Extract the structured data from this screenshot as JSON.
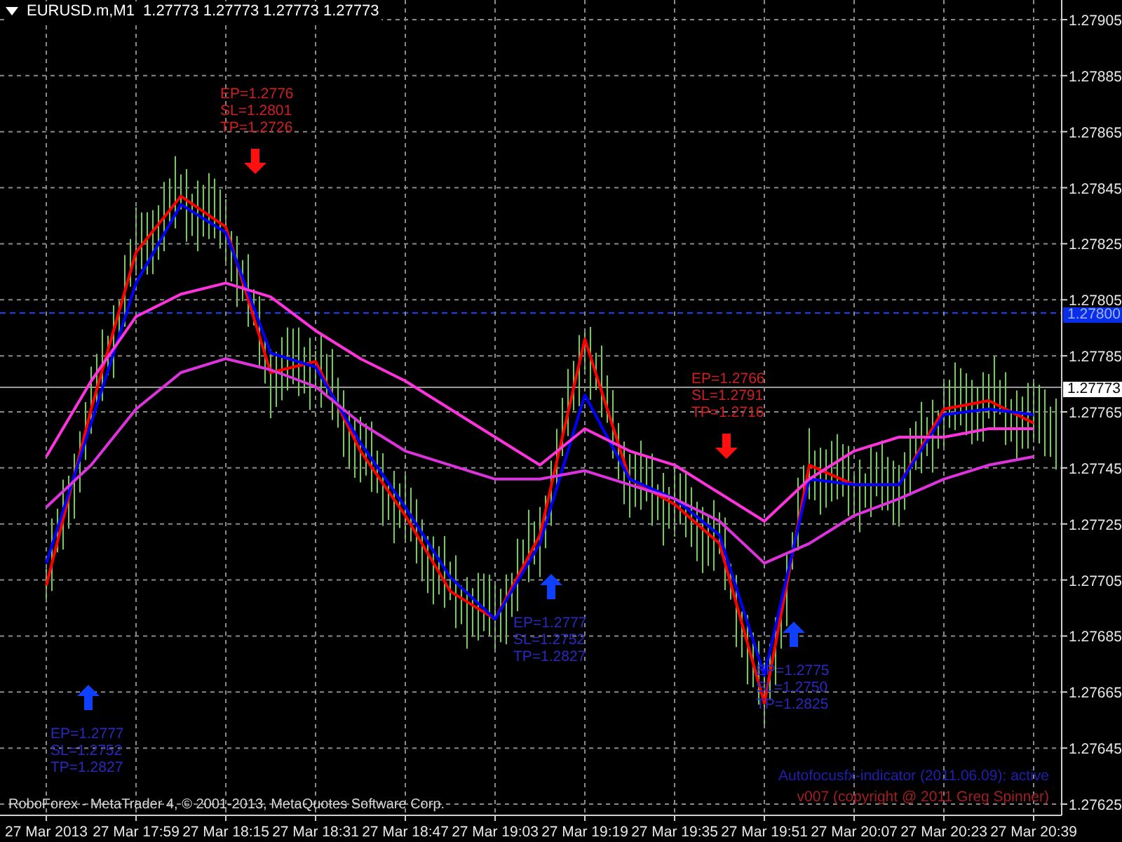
{
  "header": {
    "symbol": "EURUSD.m,M1",
    "quote": "1.27773 1.27773 1.27773 1.27773"
  },
  "chart": {
    "chart_data": {
      "type": "line",
      "grid": true,
      "ylim": [
        1.27621,
        1.27912
      ],
      "categories": [
        "27 Mar 2013",
        null,
        "27 Mar 17:59",
        null,
        "27 Mar 18:15",
        null,
        "27 Mar 18:31",
        null,
        "27 Mar 18:47",
        null,
        "27 Mar 19:03",
        null,
        "27 Mar 19:19",
        null,
        "27 Mar 19:35",
        null,
        "27 Mar 19:51",
        null,
        "27 Mar 20:07",
        null,
        "27 Mar 20:23",
        null,
        "27 Mar 20:39",
        null
      ],
      "series": [
        {
          "color": "#ff0000",
          "values": [
            1.27703,
            1.27766,
            1.27822,
            1.27842,
            1.27831,
            1.27779,
            1.27783,
            1.27751,
            1.27728,
            1.27701,
            1.27691,
            1.27721,
            1.27791,
            1.27741,
            1.27732,
            1.27718,
            1.27661,
            1.27746,
            1.27739,
            1.27739,
            1.27766,
            1.27769,
            1.27761,
            null
          ]
        },
        {
          "color": "#0000ff",
          "values": [
            1.27711,
            1.27761,
            1.27811,
            1.27839,
            1.27829,
            1.27786,
            1.27781,
            1.27754,
            1.27731,
            1.27706,
            1.27691,
            1.27718,
            1.27771,
            1.27741,
            1.27734,
            1.27721,
            1.27671,
            1.27741,
            1.27739,
            1.27739,
            1.27764,
            1.27766,
            1.27764,
            null
          ]
        },
        {
          "color": "#ff33dd",
          "values": [
            1.27749,
            1.27776,
            1.27799,
            1.27807,
            1.27811,
            1.27806,
            1.27794,
            1.27784,
            1.27776,
            1.27766,
            1.27756,
            1.27746,
            1.27759,
            1.27751,
            1.27746,
            1.27736,
            1.27726,
            1.27741,
            1.27751,
            1.27756,
            1.27756,
            1.27759,
            1.27759,
            null
          ]
        },
        {
          "color": "#dd33dd",
          "values": [
            1.27731,
            1.27746,
            1.27766,
            1.27779,
            1.27784,
            1.2778,
            1.27774,
            1.27761,
            1.27751,
            1.27746,
            1.27741,
            1.27741,
            1.27744,
            1.27739,
            1.27734,
            1.27726,
            1.27711,
            1.27718,
            1.27728,
            1.27734,
            1.27741,
            1.27746,
            1.27749,
            null
          ]
        }
      ],
      "yticks": [
        {
          "value": 1.27905,
          "label": "1.27905"
        },
        {
          "value": 1.27885,
          "label": "1.27885"
        },
        {
          "value": 1.27865,
          "label": "1.27865"
        },
        {
          "value": 1.27845,
          "label": "1.27845"
        },
        {
          "value": 1.27825,
          "label": "1.27825"
        },
        {
          "value": 1.27805,
          "label": "1.27805"
        },
        {
          "value": 1.27785,
          "label": "1.27785"
        },
        {
          "value": 1.27765,
          "label": "1.27765"
        },
        {
          "value": 1.27745,
          "label": "1.27745"
        },
        {
          "value": 1.27725,
          "label": "1.27725"
        },
        {
          "value": 1.27705,
          "label": "1.27705"
        },
        {
          "value": 1.27685,
          "label": "1.27685"
        },
        {
          "value": 1.27665,
          "label": "1.27665"
        },
        {
          "value": 1.27645,
          "label": "1.27645"
        },
        {
          "value": 1.27625,
          "label": "1.27625"
        }
      ]
    }
  },
  "price_tags": [
    {
      "kind": "level",
      "label": "1.27800"
    },
    {
      "kind": "bid",
      "label": "1.27773"
    }
  ],
  "trade_signals": [
    {
      "kind": "sell",
      "lines": [
        "EP=1.2776",
        "SL=1.2801",
        "TP=1.2726"
      ]
    },
    {
      "kind": "buy",
      "lines": [
        "EP=1.2777",
        "SL=1.2752",
        "TP=1.2827"
      ]
    },
    {
      "kind": "buy",
      "lines": [
        "EP=1.2777",
        "SL=1.2752",
        "TP=1.2827"
      ]
    },
    {
      "kind": "sell",
      "lines": [
        "EP=1.2766",
        "SL=1.2791",
        "TP=1.2716"
      ]
    },
    {
      "kind": "buy",
      "lines": [
        "EP=1.2775",
        "SL=1.2750",
        "TP=1.2825"
      ]
    }
  ],
  "indicator_status": [
    {
      "text": "Autofocusfx-indicator (2011.06.09): active",
      "color": "#2020b0"
    },
    {
      "text": "v007 (copyright @ 2011 Greg Spinner)",
      "color": "#a02020"
    }
  ],
  "copyright": "RoboForex - MetaTrader 4, © 2001-2013, MetaQuotes Software Corp."
}
